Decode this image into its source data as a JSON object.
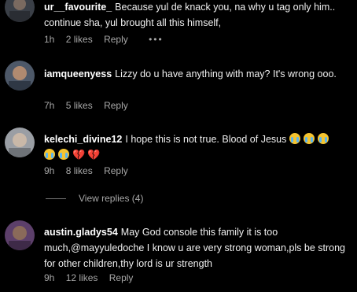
{
  "comments": [
    {
      "username": "ur__favourite_",
      "text": "Because yul de knack you, na why u tag only him.. continue sha, yul brought all this himself,",
      "time": "1h",
      "likes": "2 likes",
      "reply": "Reply",
      "more": "•••",
      "avatar_color": "#3a3f47"
    },
    {
      "username": "iamqueenyess",
      "text": "Lizzy do u have anything with may? It's wrong ooo.",
      "time": "7h",
      "likes": "5 likes",
      "reply": "Reply",
      "avatar_color": "#5a6a80"
    },
    {
      "username": "kelechi_divine12",
      "text": "I hope this is not true. Blood of Jesus",
      "time": "9h",
      "likes": "8 likes",
      "reply": "Reply",
      "avatar_color": "#8b8f95"
    },
    {
      "username": "austin.gladys54",
      "text": "May God console this family it is too much,@mayyuledoche I know u are very strong woman,pls be strong for other children,thy lord is ur strength",
      "time": "9h",
      "likes": "12 likes",
      "reply": "Reply",
      "avatar_color": "#6b4a7a"
    }
  ],
  "view_replies": "View replies (4)",
  "icons": {
    "crying": "loudly-crying-face-icon",
    "broken_heart": "broken-heart-icon"
  }
}
